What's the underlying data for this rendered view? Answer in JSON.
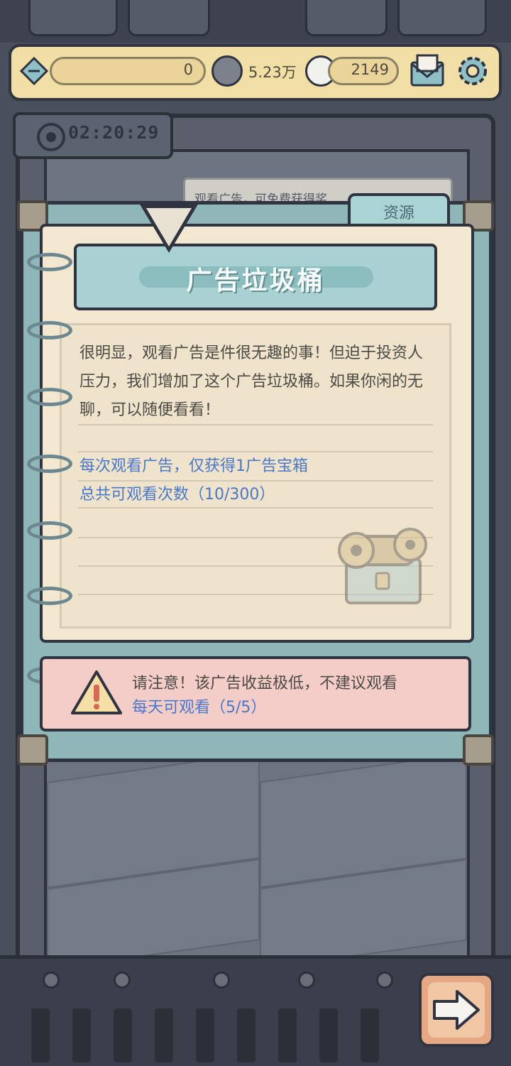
{
  "top_bar": {
    "resource_1_value": "0",
    "resource_2_value": "5.23万",
    "resource_3_value": "2149"
  },
  "timer": {
    "value": "02:20:29"
  },
  "background_paper": {
    "text": "观看广告，可免费获得奖"
  },
  "notebook": {
    "tab_label": "资源",
    "title": "广告垃圾桶",
    "description": "很明显，观看广告是件很无趣的事！但迫于投资人压力，我们增加了这个广告垃圾桶。如果你闲的无聊，可以随便看看！",
    "reward_note": "每次观看广告，仅获得1广告宝箱",
    "total_views": "总共可观看次数（10/300）"
  },
  "warning": {
    "message": "请注意！该广告收益极低，不建议观看",
    "daily_views": "每天可观看（5/5）"
  },
  "colors": {
    "accent_teal": "#a9d1d1",
    "paper": "#f2e7d0",
    "warning_bg": "#f4cdc8",
    "link_blue": "#4a78c9",
    "next_button": "#e5a882"
  }
}
